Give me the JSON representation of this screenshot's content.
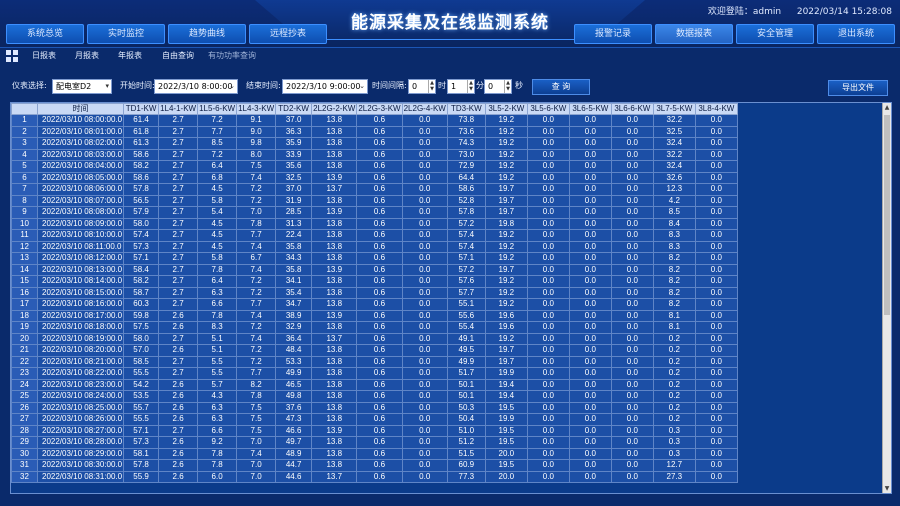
{
  "header": {
    "title": "能源采集及在线监测系统",
    "user_label": "欢迎登陆：admin",
    "datetime": "2022/03/14 15:28:08",
    "left_nav": [
      "系统总览",
      "实时监控",
      "趋势曲线",
      "远程抄表"
    ],
    "right_nav": [
      "报警记录",
      "数据报表",
      "安全管理",
      "退出系统"
    ]
  },
  "subnav": {
    "items": [
      "日报表",
      "月报表",
      "年报表",
      "自由查询",
      "有功功率查询"
    ]
  },
  "toolbar": {
    "meter_label": "仪表选择:",
    "meter_value": "配电室D2",
    "start_label": "开始时间:",
    "start_value": "2022/3/10 8:00:00",
    "end_label": "结束时间:",
    "end_value": "2022/3/10 9:00:00",
    "interval_label": "时间间隔:",
    "hour_value": "0",
    "hour_unit": "时",
    "min_value": "1",
    "min_unit": "分",
    "sec_value": "0",
    "sec_unit": "秒",
    "query_label": "查 询",
    "export_label": "导出文件"
  },
  "table": {
    "columns": [
      "",
      "时间",
      "TD1-KW",
      "1L4-1-KW",
      "1L5-6-KW",
      "1L4-3-KW",
      "TD2-KW",
      "2L2G-2-KW",
      "2L2G-3-KW",
      "2L2G-4-KW",
      "TD3-KW",
      "3L5-2-KW",
      "3L5-6-KW",
      "3L6-5-KW",
      "3L6-6-KW",
      "3L7-5-KW",
      "3L8-4-KW"
    ],
    "rows": [
      [
        "1",
        "2022/03/10 08:00:00.0",
        "61.4",
        "2.7",
        "7.2",
        "9.1",
        "37.0",
        "13.8",
        "0.6",
        "0.0",
        "73.8",
        "19.2",
        "0.0",
        "0.0",
        "0.0",
        "32.2",
        "0.0"
      ],
      [
        "2",
        "2022/03/10 08:01:00.0",
        "61.8",
        "2.7",
        "7.7",
        "9.0",
        "36.3",
        "13.8",
        "0.6",
        "0.0",
        "73.6",
        "19.2",
        "0.0",
        "0.0",
        "0.0",
        "32.5",
        "0.0"
      ],
      [
        "3",
        "2022/03/10 08:02:00.0",
        "61.3",
        "2.7",
        "8.5",
        "9.8",
        "35.9",
        "13.8",
        "0.6",
        "0.0",
        "74.3",
        "19.2",
        "0.0",
        "0.0",
        "0.0",
        "32.4",
        "0.0"
      ],
      [
        "4",
        "2022/03/10 08:03:00.0",
        "58.6",
        "2.7",
        "7.2",
        "8.0",
        "33.9",
        "13.8",
        "0.6",
        "0.0",
        "73.0",
        "19.2",
        "0.0",
        "0.0",
        "0.0",
        "32.2",
        "0.0"
      ],
      [
        "5",
        "2022/03/10 08:04:00.0",
        "58.2",
        "2.7",
        "6.4",
        "7.5",
        "35.6",
        "13.8",
        "0.6",
        "0.0",
        "72.9",
        "19.2",
        "0.0",
        "0.0",
        "0.0",
        "32.4",
        "0.0"
      ],
      [
        "6",
        "2022/03/10 08:05:00.0",
        "58.6",
        "2.7",
        "6.8",
        "7.4",
        "32.5",
        "13.9",
        "0.6",
        "0.0",
        "64.4",
        "19.2",
        "0.0",
        "0.0",
        "0.0",
        "32.6",
        "0.0"
      ],
      [
        "7",
        "2022/03/10 08:06:00.0",
        "57.8",
        "2.7",
        "4.5",
        "7.2",
        "37.0",
        "13.7",
        "0.6",
        "0.0",
        "58.6",
        "19.7",
        "0.0",
        "0.0",
        "0.0",
        "12.3",
        "0.0"
      ],
      [
        "8",
        "2022/03/10 08:07:00.0",
        "56.5",
        "2.7",
        "5.8",
        "7.2",
        "31.9",
        "13.8",
        "0.6",
        "0.0",
        "52.8",
        "19.7",
        "0.0",
        "0.0",
        "0.0",
        "4.2",
        "0.0"
      ],
      [
        "9",
        "2022/03/10 08:08:00.0",
        "57.9",
        "2.7",
        "5.4",
        "7.0",
        "28.5",
        "13.9",
        "0.6",
        "0.0",
        "57.8",
        "19.7",
        "0.0",
        "0.0",
        "0.0",
        "8.5",
        "0.0"
      ],
      [
        "10",
        "2022/03/10 08:09:00.0",
        "58.0",
        "2.7",
        "4.5",
        "7.8",
        "31.3",
        "13.8",
        "0.6",
        "0.0",
        "57.2",
        "19.8",
        "0.0",
        "0.0",
        "0.0",
        "8.4",
        "0.0"
      ],
      [
        "11",
        "2022/03/10 08:10:00.0",
        "57.4",
        "2.7",
        "4.5",
        "7.7",
        "22.4",
        "13.8",
        "0.6",
        "0.0",
        "57.4",
        "19.2",
        "0.0",
        "0.0",
        "0.0",
        "8.3",
        "0.0"
      ],
      [
        "12",
        "2022/03/10 08:11:00.0",
        "57.3",
        "2.7",
        "4.5",
        "7.4",
        "35.8",
        "13.8",
        "0.6",
        "0.0",
        "57.4",
        "19.2",
        "0.0",
        "0.0",
        "0.0",
        "8.3",
        "0.0"
      ],
      [
        "13",
        "2022/03/10 08:12:00.0",
        "57.1",
        "2.7",
        "5.8",
        "6.7",
        "34.3",
        "13.8",
        "0.6",
        "0.0",
        "57.1",
        "19.2",
        "0.0",
        "0.0",
        "0.0",
        "8.2",
        "0.0"
      ],
      [
        "14",
        "2022/03/10 08:13:00.0",
        "58.4",
        "2.7",
        "7.8",
        "7.4",
        "35.8",
        "13.9",
        "0.6",
        "0.0",
        "57.2",
        "19.7",
        "0.0",
        "0.0",
        "0.0",
        "8.2",
        "0.0"
      ],
      [
        "15",
        "2022/03/10 08:14:00.0",
        "58.2",
        "2.7",
        "6.4",
        "7.2",
        "34.1",
        "13.8",
        "0.6",
        "0.0",
        "57.6",
        "19.2",
        "0.0",
        "0.0",
        "0.0",
        "8.2",
        "0.0"
      ],
      [
        "16",
        "2022/03/10 08:15:00.0",
        "58.7",
        "2.7",
        "6.3",
        "7.2",
        "35.4",
        "13.8",
        "0.6",
        "0.0",
        "57.7",
        "19.2",
        "0.0",
        "0.0",
        "0.0",
        "8.2",
        "0.0"
      ],
      [
        "17",
        "2022/03/10 08:16:00.0",
        "60.3",
        "2.7",
        "6.6",
        "7.7",
        "34.7",
        "13.8",
        "0.6",
        "0.0",
        "55.1",
        "19.2",
        "0.0",
        "0.0",
        "0.0",
        "8.2",
        "0.0"
      ],
      [
        "18",
        "2022/03/10 08:17:00.0",
        "59.8",
        "2.6",
        "7.8",
        "7.4",
        "38.9",
        "13.9",
        "0.6",
        "0.0",
        "55.6",
        "19.6",
        "0.0",
        "0.0",
        "0.0",
        "8.1",
        "0.0"
      ],
      [
        "19",
        "2022/03/10 08:18:00.0",
        "57.5",
        "2.6",
        "8.3",
        "7.2",
        "32.9",
        "13.8",
        "0.6",
        "0.0",
        "55.4",
        "19.6",
        "0.0",
        "0.0",
        "0.0",
        "8.1",
        "0.0"
      ],
      [
        "20",
        "2022/03/10 08:19:00.0",
        "58.0",
        "2.7",
        "5.1",
        "7.4",
        "36.4",
        "13.7",
        "0.6",
        "0.0",
        "49.1",
        "19.2",
        "0.0",
        "0.0",
        "0.0",
        "0.2",
        "0.0"
      ],
      [
        "21",
        "2022/03/10 08:20:00.0",
        "57.0",
        "2.6",
        "5.1",
        "7.2",
        "48.4",
        "13.8",
        "0.6",
        "0.0",
        "49.5",
        "19.7",
        "0.0",
        "0.0",
        "0.0",
        "0.2",
        "0.0"
      ],
      [
        "22",
        "2022/03/10 08:21:00.0",
        "58.5",
        "2.7",
        "5.5",
        "7.2",
        "53.3",
        "13.8",
        "0.6",
        "0.0",
        "49.9",
        "19.7",
        "0.0",
        "0.0",
        "0.0",
        "0.2",
        "0.0"
      ],
      [
        "23",
        "2022/03/10 08:22:00.0",
        "55.5",
        "2.7",
        "5.5",
        "7.7",
        "49.9",
        "13.8",
        "0.6",
        "0.0",
        "51.7",
        "19.9",
        "0.0",
        "0.0",
        "0.0",
        "0.2",
        "0.0"
      ],
      [
        "24",
        "2022/03/10 08:23:00.0",
        "54.2",
        "2.6",
        "5.7",
        "8.2",
        "46.5",
        "13.8",
        "0.6",
        "0.0",
        "50.1",
        "19.4",
        "0.0",
        "0.0",
        "0.0",
        "0.2",
        "0.0"
      ],
      [
        "25",
        "2022/03/10 08:24:00.0",
        "53.5",
        "2.6",
        "4.3",
        "7.8",
        "49.8",
        "13.8",
        "0.6",
        "0.0",
        "50.1",
        "19.4",
        "0.0",
        "0.0",
        "0.0",
        "0.2",
        "0.0"
      ],
      [
        "26",
        "2022/03/10 08:25:00.0",
        "55.7",
        "2.6",
        "6.3",
        "7.5",
        "37.6",
        "13.8",
        "0.6",
        "0.0",
        "50.3",
        "19.5",
        "0.0",
        "0.0",
        "0.0",
        "0.2",
        "0.0"
      ],
      [
        "27",
        "2022/03/10 08:26:00.0",
        "55.5",
        "2.6",
        "6.3",
        "7.5",
        "47.3",
        "13.8",
        "0.6",
        "0.0",
        "50.4",
        "19.9",
        "0.0",
        "0.0",
        "0.0",
        "0.2",
        "0.0"
      ],
      [
        "28",
        "2022/03/10 08:27:00.0",
        "57.1",
        "2.7",
        "6.6",
        "7.5",
        "46.6",
        "13.9",
        "0.6",
        "0.0",
        "51.0",
        "19.5",
        "0.0",
        "0.0",
        "0.0",
        "0.3",
        "0.0"
      ],
      [
        "29",
        "2022/03/10 08:28:00.0",
        "57.3",
        "2.6",
        "9.2",
        "7.0",
        "49.7",
        "13.8",
        "0.6",
        "0.0",
        "51.2",
        "19.5",
        "0.0",
        "0.0",
        "0.0",
        "0.3",
        "0.0"
      ],
      [
        "30",
        "2022/03/10 08:29:00.0",
        "58.1",
        "2.6",
        "7.8",
        "7.4",
        "48.9",
        "13.8",
        "0.6",
        "0.0",
        "51.5",
        "20.0",
        "0.0",
        "0.0",
        "0.0",
        "0.3",
        "0.0"
      ],
      [
        "31",
        "2022/03/10 08:30:00.0",
        "57.8",
        "2.6",
        "7.8",
        "7.0",
        "44.7",
        "13.8",
        "0.6",
        "0.0",
        "60.9",
        "19.5",
        "0.0",
        "0.0",
        "0.0",
        "12.7",
        "0.0"
      ],
      [
        "32",
        "2022/03/10 08:31:00.0",
        "55.9",
        "2.6",
        "6.0",
        "7.0",
        "44.6",
        "13.7",
        "0.6",
        "0.0",
        "77.3",
        "20.0",
        "0.0",
        "0.0",
        "0.0",
        "27.3",
        "0.0"
      ]
    ]
  },
  "colors": {
    "background": "#0a2a6b",
    "table_cell": "#1c4fa6",
    "header_cell": "#c9d9f5",
    "accent": "#3d8fff"
  }
}
